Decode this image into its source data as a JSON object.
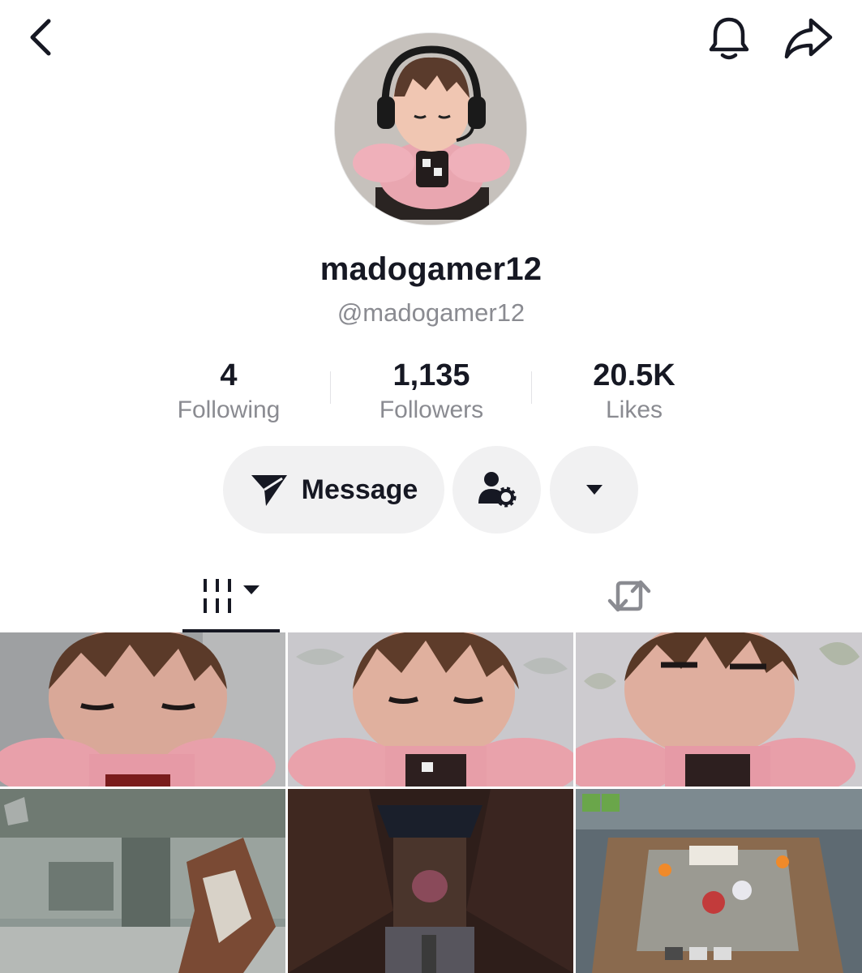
{
  "topbar": {
    "back_icon": "chevron-left-icon",
    "bell_icon": "bell-icon",
    "share_icon": "share-arrow-icon"
  },
  "profile": {
    "display_name": "madogamer12",
    "handle": "@madogamer12"
  },
  "stats": [
    {
      "value": "4",
      "label": "Following"
    },
    {
      "value": "1,135",
      "label": "Followers"
    },
    {
      "value": "20.5K",
      "label": "Likes"
    }
  ],
  "actions": {
    "message_label": "Message",
    "message_icon": "paper-plane-icon",
    "follow_settings_icon": "person-gear-icon",
    "more_icon": "caret-down-icon"
  },
  "tabs": [
    {
      "name": "videos",
      "icon": "grid-bars-icon",
      "active": true
    },
    {
      "name": "reposts",
      "icon": "repost-icon",
      "active": false
    }
  ],
  "colors": {
    "text_primary": "#161823",
    "text_secondary": "#8a8b91",
    "button_bg": "#f1f1f2"
  }
}
